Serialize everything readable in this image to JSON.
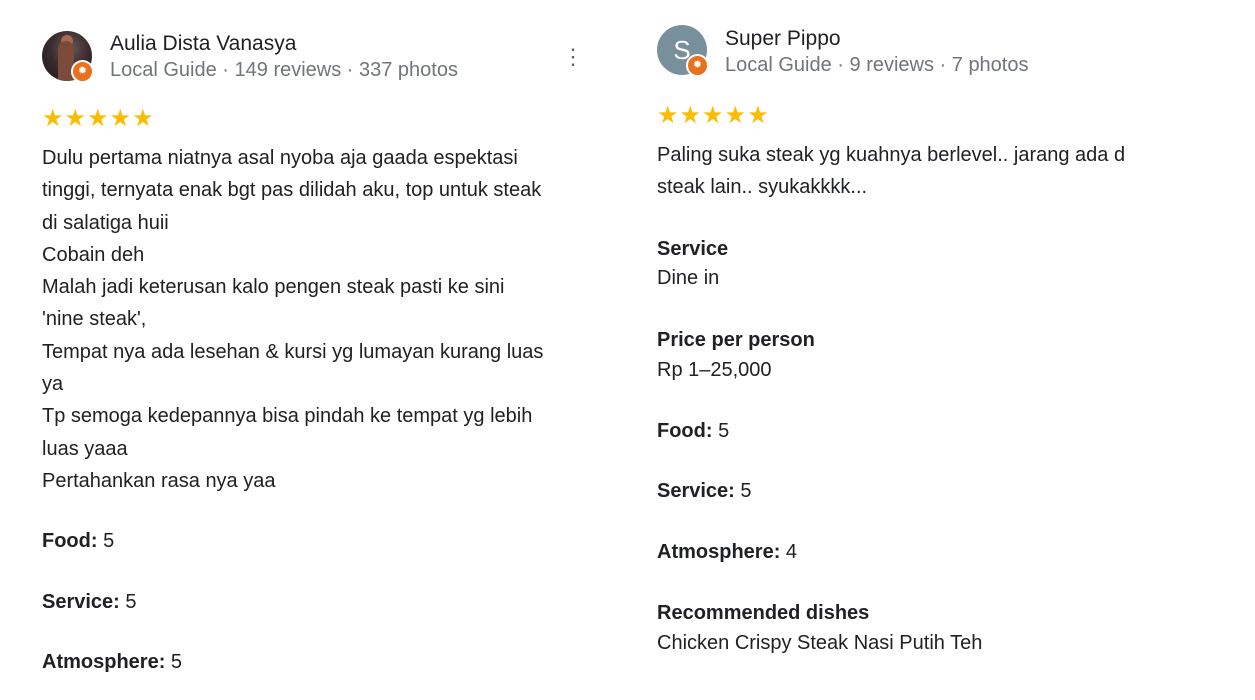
{
  "reviews": [
    {
      "author": "Aulia Dista Vanasya",
      "meta": "Local Guide · 149 reviews · 337 photos",
      "stars": "★★★★★",
      "rating": 5,
      "text_lines": [
        "Dulu pertama niatnya asal nyoba aja gaada espektasi",
        "tinggi, ternyata enak bgt pas dilidah aku, top untuk steak",
        "di salatiga huii",
        "Cobain deh",
        "Malah jadi keterusan kalo pengen steak pasti ke sini",
        "'nine steak',",
        "Tempat nya ada lesehan & kursi yg lumayan kurang luas",
        "ya",
        "Tp semoga kedepannya bisa pindah ke tempat yg lebih",
        "luas yaaa",
        "Pertahankan rasa nya yaa"
      ],
      "food_label": "Food:",
      "food_value": "5",
      "service_label": "Service:",
      "service_value": "5",
      "atmosphere_label": "Atmosphere:",
      "atmosphere_value": "5",
      "more_icon": "more-vert-icon"
    },
    {
      "author": "Super Pippo",
      "avatar_letter": "S",
      "meta": "Local Guide · 9 reviews · 7 photos",
      "stars": "★★★★★",
      "rating": 5,
      "text_lines": [
        "Paling suka steak yg kuahnya berlevel.. jarang ada d",
        "steak lain.. syukakkkk..."
      ],
      "service_heading": "Service",
      "service_text": "Dine in",
      "price_heading": "Price per person",
      "price_text": "Rp 1–25,000",
      "food_label": "Food:",
      "food_value": "5",
      "service_label": "Service:",
      "service_value": "5",
      "atmosphere_label": "Atmosphere:",
      "atmosphere_value": "4",
      "dishes_heading": "Recommended dishes",
      "dishes_text": "Chicken Crispy Steak Nasi Putih Teh"
    }
  ],
  "colors": {
    "star": "#fbbc04",
    "meta_text": "#70757a",
    "badge": "#e8711c",
    "letter_avatar": "#78909c"
  }
}
